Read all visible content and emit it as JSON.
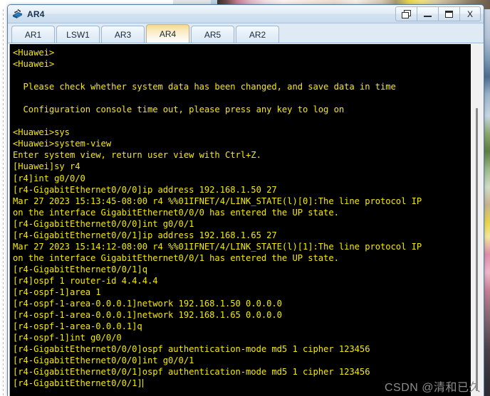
{
  "window": {
    "title": "AR4",
    "icon": "router-icon",
    "buttons": [
      {
        "name": "restore-cascade-button",
        "icon": "cascade-icon",
        "label": ""
      },
      {
        "name": "minimize-button",
        "icon": "minimize-icon",
        "label": ""
      },
      {
        "name": "maximize-button",
        "icon": "maximize-icon",
        "label": ""
      },
      {
        "name": "close-button",
        "icon": "close-icon",
        "label": "X"
      }
    ]
  },
  "tabs": [
    {
      "label": "AR1",
      "active": false
    },
    {
      "label": "LSW1",
      "active": false
    },
    {
      "label": "AR3",
      "active": false
    },
    {
      "label": "AR4",
      "active": true
    },
    {
      "label": "AR5",
      "active": false
    },
    {
      "label": "AR2",
      "active": false
    }
  ],
  "console": {
    "prompt_cursor": true,
    "lines": [
      "<Huawei>",
      "<Huawei>",
      "",
      "  Please check whether system data has been changed, and save data in time",
      "",
      "  Configuration console time out, please press any key to log on",
      "",
      "<Huawei>sys",
      "<Huawei>system-view",
      "Enter system view, return user view with Ctrl+Z.",
      "[Huawei]sy r4",
      "[r4]int g0/0/0",
      "[r4-GigabitEthernet0/0/0]ip address 192.168.1.50 27",
      "Mar 27 2023 15:13:45-08:00 r4 %%01IFNET/4/LINK_STATE(l)[0]:The line protocol IP",
      "on the interface GigabitEthernet0/0/0 has entered the UP state.",
      "[r4-GigabitEthernet0/0/0]int g0/0/1",
      "[r4-GigabitEthernet0/0/1]ip address 192.168.1.65 27",
      "Mar 27 2023 15:14:12-08:00 r4 %%01IFNET/4/LINK_STATE(l)[1]:The line protocol IP",
      "on the interface GigabitEthernet0/0/1 has entered the UP state.",
      "[r4-GigabitEthernet0/0/1]q",
      "[r4]ospf 1 router-id 4.4.4.4",
      "[r4-ospf-1]area 1",
      "[r4-ospf-1-area-0.0.0.1]network 192.168.1.50 0.0.0.0",
      "[r4-ospf-1-area-0.0.0.1]network 192.168.1.65 0.0.0.0",
      "[r4-ospf-1-area-0.0.0.1]q",
      "[r4-ospf-1]int g0/0/0",
      "[r4-GigabitEthernet0/0/0]ospf authentication-mode md5 1 cipher 123456",
      "[r4-GigabitEthernet0/0/0]int g0/0/1",
      "[r4-GigabitEthernet0/0/1]ospf authentication-mode md5 1 cipher 123456",
      "[r4-GigabitEthernet0/0/1]"
    ],
    "colors": {
      "background": "#000000",
      "text": "#f3e900"
    }
  },
  "watermark": {
    "text": "CSDN @清和已久"
  }
}
